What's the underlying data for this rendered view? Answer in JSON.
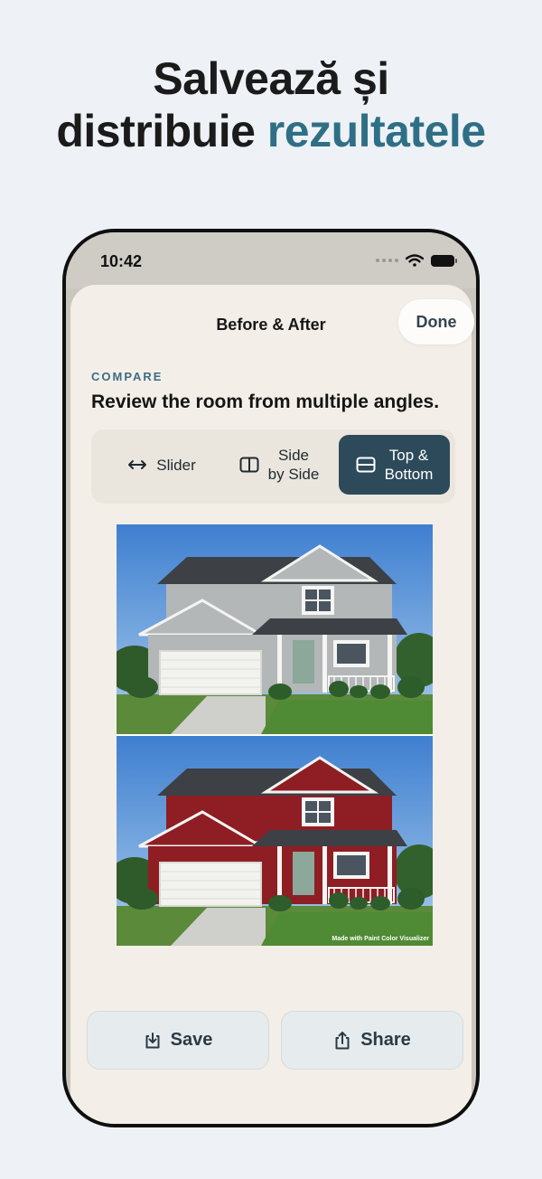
{
  "headline": {
    "line1": "Salvează și",
    "line2_plain": "distribuie ",
    "line2_accent": "rezultatele"
  },
  "status": {
    "time": "10:42"
  },
  "nav": {
    "title": "Before & After",
    "done_label": "Done"
  },
  "compare": {
    "eyebrow": "COMPARE",
    "subtitle": "Review the room from multiple angles.",
    "modes": [
      {
        "label": "Slider",
        "icon": "arrows-horizontal-icon",
        "selected": false
      },
      {
        "label_line1": "Side",
        "label_line2": "by Side",
        "icon": "split-columns-icon",
        "selected": false
      },
      {
        "label_line1": "Top &",
        "label_line2": "Bottom",
        "icon": "split-rows-icon",
        "selected": true
      }
    ],
    "before_siding_color": "#b3b7b7",
    "after_siding_color": "#8e1e24",
    "watermark": "Made with Paint Color Visualizer"
  },
  "actions": {
    "save_label": "Save",
    "share_label": "Share"
  },
  "colors": {
    "accent": "#2f6f86",
    "selected_mode": "#2d4a5b",
    "sheet": "#f3efe8"
  }
}
